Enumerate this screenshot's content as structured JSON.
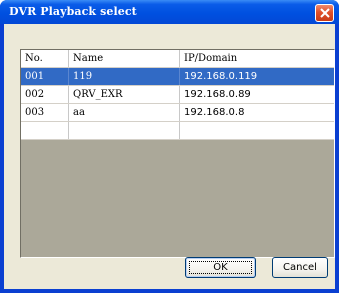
{
  "window": {
    "title": "DVR Playback select"
  },
  "table": {
    "columns": [
      "No.",
      "Name",
      "IP/Domain"
    ],
    "rows": [
      {
        "no": "001",
        "name": "119",
        "ip": "192.168.0.119",
        "selected": true
      },
      {
        "no": "002",
        "name": "QRV_EXR",
        "ip": "192.168.0.89",
        "selected": false
      },
      {
        "no": "003",
        "name": "aa",
        "ip": "192.168.0.8",
        "selected": false
      },
      {
        "no": "",
        "name": "",
        "ip": "",
        "selected": false
      }
    ]
  },
  "buttons": {
    "ok_label": "OK",
    "cancel_label": "Cancel"
  },
  "colors": {
    "titlebar": "#0050e0",
    "selection": "#316ac5",
    "close_button": "#e0502b",
    "dialog_face": "#ece9d8",
    "empty_grid": "#aba899"
  }
}
